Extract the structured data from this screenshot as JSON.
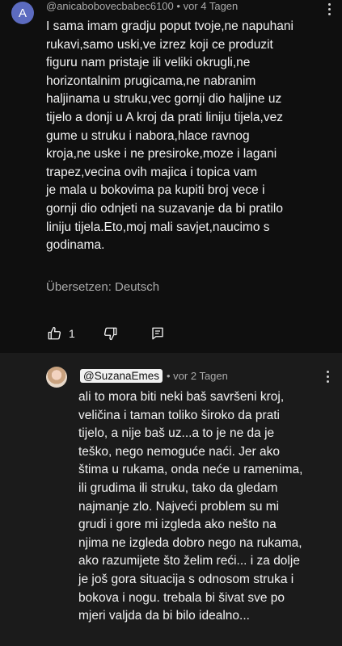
{
  "comment": {
    "avatar_letter": "A",
    "author": "@anicabobovecbabec6100",
    "time": "vor 4 Tagen",
    "text": "I sama imam gradju poput tvoje,ne napuhani\nrukavi,samo uski,ve izrez koji ce produzit\nfiguru nam pristaje ili veliki okrugli,ne\nhorizontalnim prugicama,ne nabranim\nhaljinama u struku,vec gornji dio haljine uz\ntijelo a donji u A kroj da prati liniju tijela,vez\ngume u struku i nabora,hlace ravnog\nkroja,ne uske i ne presiroke,moze i lagani\ntrapez,vecina ovih majica i topica vam\nje mala u bokovima pa kupiti broj vece i\ngornji dio odnjeti na suzavanje da bi pratilo\nliniju tijela.Eto,moj mali savjet,naucimo s\ngodinama.",
    "translate_label": "Übersetzen: Deutsch",
    "like_count": "1"
  },
  "reply": {
    "author": "@SuzanaEmes",
    "time": "vor 2 Tagen",
    "text": "ali  to mora biti neki baš savršeni kroj,\nveličina i taman toliko široko da prati\ntijelo, a nije baš uz...a to je ne da je\nteško, nego nemoguće naći. Jer ako\nštima u rukama, onda neće u ramenima,\nili grudima ili struku, tako da gledam\nnajmanje zlo. Najveći problem su mi\ngrudi i gore mi izgleda ako nešto na\nnjima ne izgleda dobro nego na rukama,\nako razumijete što želim reći... i za dolje\nje još gora situacija s odnosom struka i\nbokova i nogu. trebala bi šivat sve po\nmjeri valjda da bi bilo idealno..."
  },
  "colors": {
    "background": "#0f0f0f",
    "reply_background": "#1b1b1b",
    "text": "#f1f1f1",
    "secondary_text": "#aaaaaa",
    "avatar_a": "#5c6bc0"
  },
  "icons": [
    "thumb-up-icon",
    "thumb-down-icon",
    "reply-icon",
    "more-vert-icon"
  ]
}
